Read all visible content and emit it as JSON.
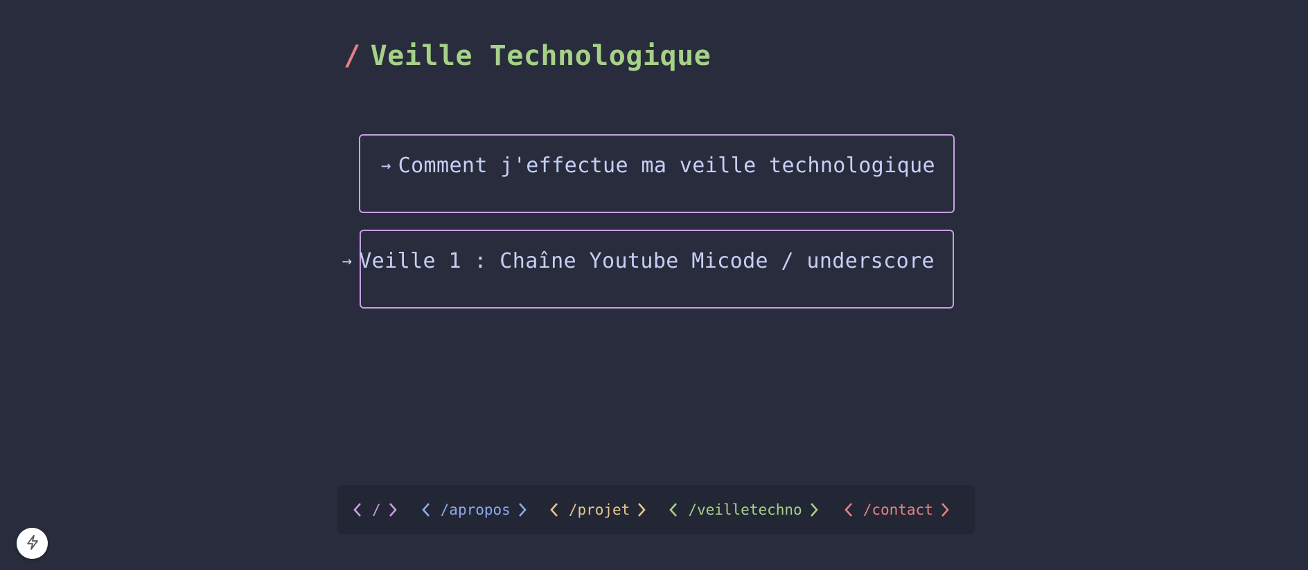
{
  "header": {
    "slash": "/",
    "title": "Veille Technologique"
  },
  "cards": [
    {
      "arrow": "→",
      "label": "Comment j'effectue ma veille technologique"
    },
    {
      "arrow": "→",
      "label": "Veille 1 : Chaîne Youtube Micode / underscore"
    }
  ],
  "nav": {
    "home": "/",
    "apropos": "/apropos",
    "projet": "/projet",
    "veilletechno": "/veilletechno",
    "contact": "/contact"
  },
  "colors": {
    "background": "#292c3c",
    "nav_background": "#232634",
    "title": "#a6d189",
    "slash": "#e78284",
    "card_border": "#ca9ee6",
    "card_text": "#c6d0f5",
    "home": "#ca9ee6",
    "apropos": "#8caaee",
    "projet": "#e5c890",
    "veilletechno": "#a6d189",
    "contact": "#e78284"
  },
  "icons": {
    "floating_button": "lightning-bolt-icon",
    "nav_open": "chevron-left-icon",
    "nav_close": "chevron-right-icon"
  }
}
